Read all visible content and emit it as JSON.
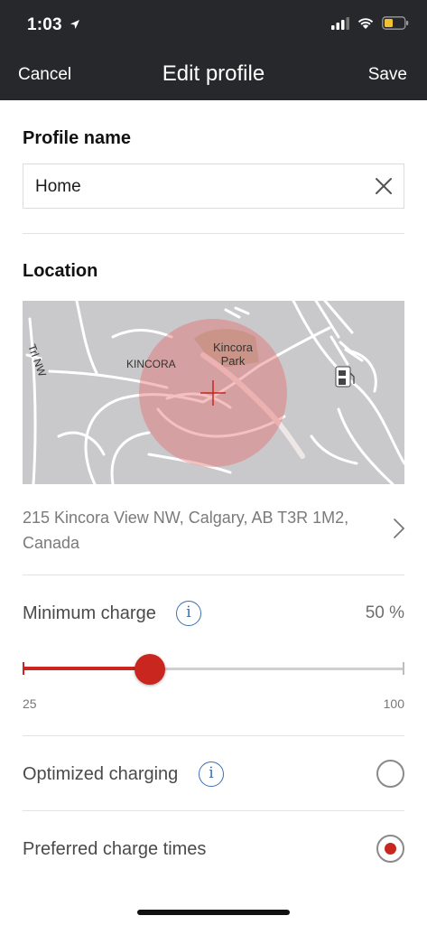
{
  "status_bar": {
    "time": "1:03"
  },
  "nav": {
    "cancel_label": "Cancel",
    "title": "Edit profile",
    "save_label": "Save"
  },
  "profile_name": {
    "heading": "Profile name",
    "value": "Home"
  },
  "location": {
    "heading": "Location",
    "map_labels": {
      "park": [
        "Kincora",
        "Park"
      ],
      "neighborhood": "KINCORA",
      "road": "Trl NW"
    },
    "address_line1": "215 Kincora View NW, Calgary, AB T3R 1M2,",
    "address_line2": "Canada"
  },
  "minimum_charge": {
    "label": "Minimum charge",
    "value_text": "50 %",
    "slider_value": 50,
    "slider_min": 25,
    "slider_max": 100,
    "min_label": "25",
    "max_label": "100"
  },
  "optimized_charging": {
    "label": "Optimized charging",
    "selected": false
  },
  "preferred_times": {
    "label": "Preferred charge times",
    "selected": true
  },
  "colors": {
    "accent": "#c8261e",
    "info": "#3a6fb0",
    "nav_bg": "#26282b"
  }
}
